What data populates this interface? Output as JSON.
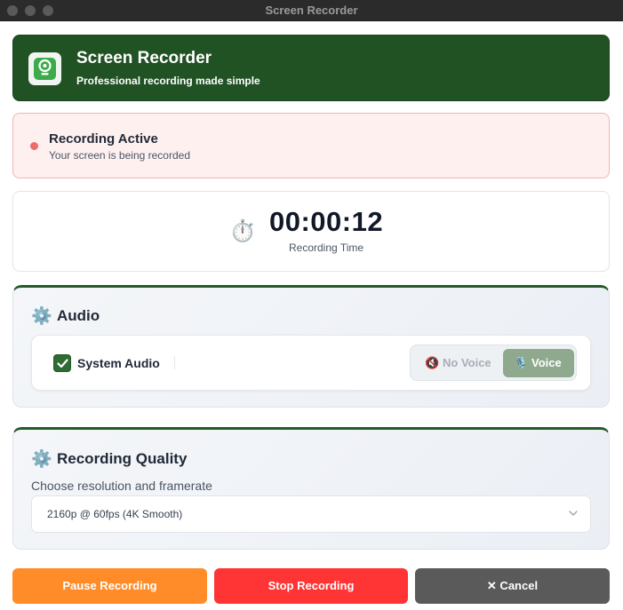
{
  "window": {
    "title": "Screen Recorder"
  },
  "header": {
    "title": "Screen Recorder",
    "subtitle": "Professional recording made simple",
    "icon": "webcam-icon"
  },
  "status": {
    "title": "Recording Active",
    "subtitle": "Your screen is being recorded",
    "dot_color": "#ef6b6b"
  },
  "timer": {
    "icon": "⏱️",
    "value": "00:00:12",
    "label": "Recording Time"
  },
  "audio": {
    "icon": "⚙️",
    "title": "Audio",
    "system_audio": {
      "label": "System Audio",
      "checked": true
    },
    "voice_toggle": {
      "no_voice": {
        "icon": "🔇",
        "label": "No Voice"
      },
      "voice": {
        "icon": "🎙️",
        "label": "Voice"
      },
      "selected": "voice"
    }
  },
  "quality": {
    "icon": "⚙️",
    "title": "Recording Quality",
    "description": "Choose resolution and framerate",
    "selected_option": "2160p @ 60fps (4K Smooth)"
  },
  "buttons": {
    "pause": "Pause Recording",
    "stop": "Stop Recording",
    "cancel": "✕ Cancel"
  },
  "colors": {
    "brand_green": "#215224",
    "pause": "#ff8c28",
    "stop": "#ff3434",
    "cancel": "#5a5a5a"
  }
}
